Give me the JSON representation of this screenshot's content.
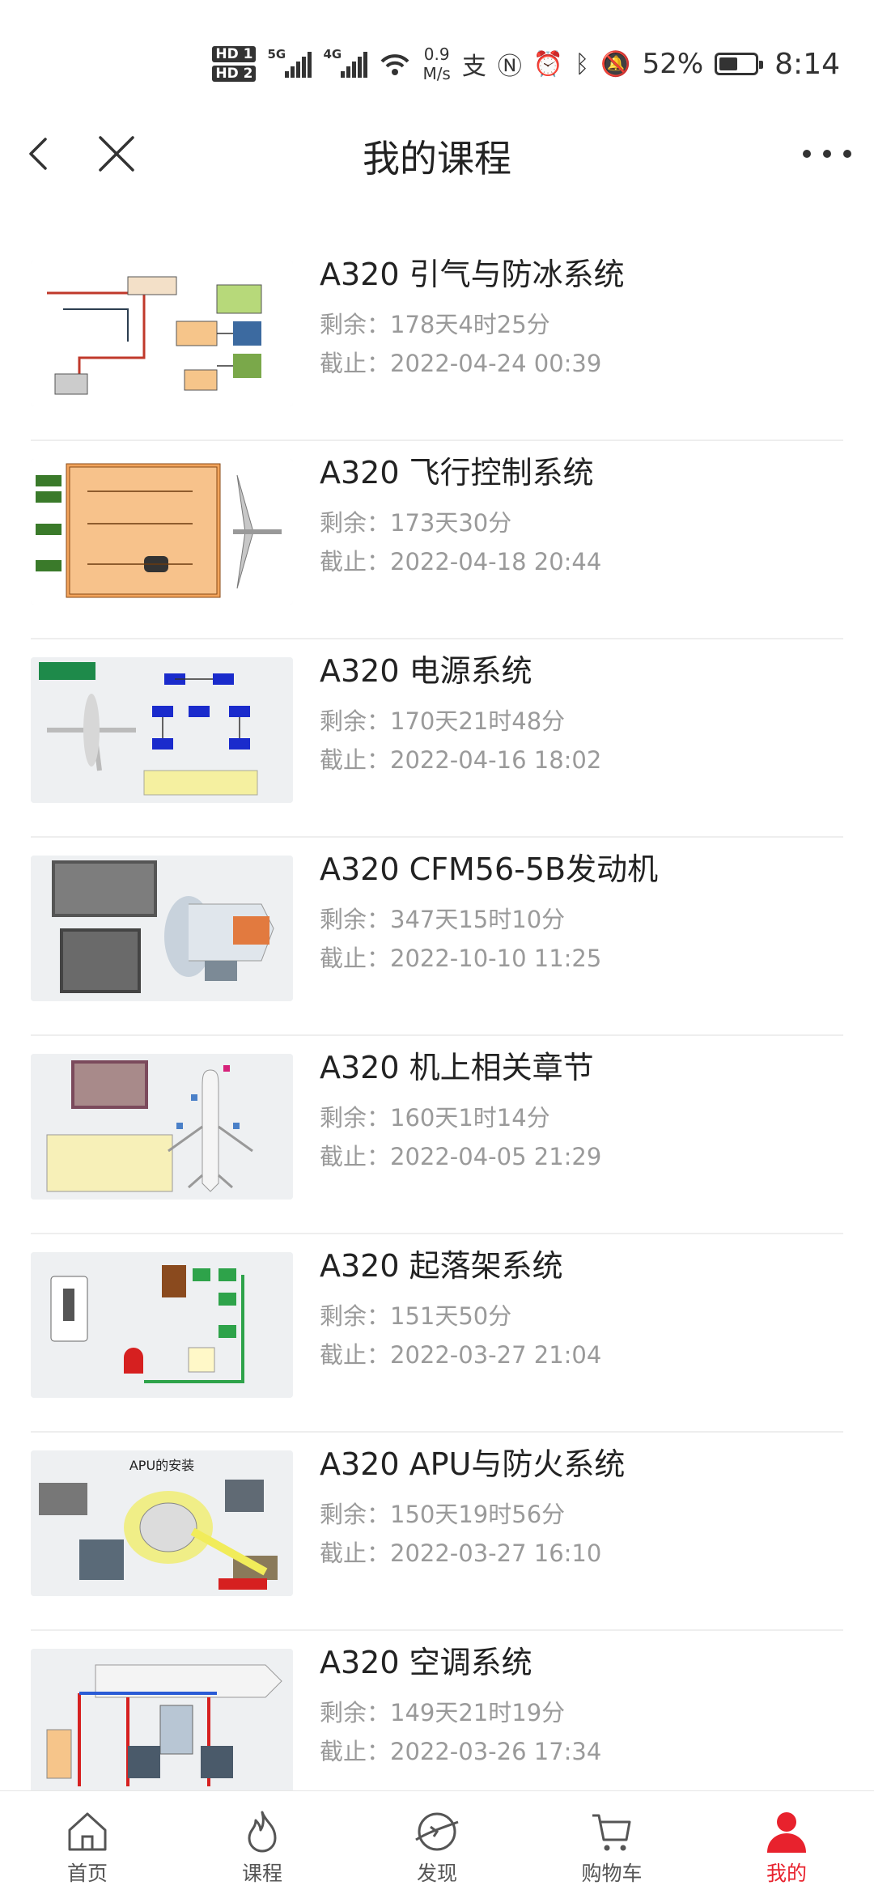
{
  "status_bar": {
    "hd1": "HD 1",
    "hd2": "HD 2",
    "sig1_label": "5G",
    "sig2_label": "4G",
    "speed_value": "0.9",
    "speed_unit": "M/s",
    "battery": "52%",
    "battery_level": 0.52,
    "time": "8:14"
  },
  "header": {
    "title": "我的课程"
  },
  "courses": [
    {
      "title": "A320 引气与防冰系统",
      "remain": "剩余：178天4时25分",
      "deadline": "截止：2022-04-24 00:39",
      "thumb_icon": "bleed-air-diagram-icon"
    },
    {
      "title": "A320 飞行控制系统",
      "remain": "剩余：173天30分",
      "deadline": "截止：2022-04-18 20:44",
      "thumb_icon": "flight-control-diagram-icon"
    },
    {
      "title": "A320 电源系统",
      "remain": "剩余：170天21时48分",
      "deadline": "截止：2022-04-16 18:02",
      "thumb_icon": "electrical-diagram-icon"
    },
    {
      "title": "A320 CFM56-5B发动机",
      "remain": "剩余：347天15时10分",
      "deadline": "截止：2022-10-10 11:25",
      "thumb_icon": "engine-diagram-icon"
    },
    {
      "title": "A320 机上相关章节",
      "remain": "剩余：160天1时14分",
      "deadline": "截止：2022-04-05 21:29",
      "thumb_icon": "aircraft-stations-diagram-icon"
    },
    {
      "title": "A320 起落架系统",
      "remain": "剩余：151天50分",
      "deadline": "截止：2022-03-27 21:04",
      "thumb_icon": "landing-gear-diagram-icon"
    },
    {
      "title": "A320 APU与防火系统",
      "remain": "剩余：150天19时56分",
      "deadline": "截止：2022-03-27 16:10",
      "thumb_icon": "apu-diagram-icon",
      "thumb_caption": "APU的安装"
    },
    {
      "title": "A320 空调系统",
      "remain": "剩余：149天21时19分",
      "deadline": "截止：2022-03-26 17:34",
      "thumb_icon": "air-conditioning-diagram-icon"
    }
  ],
  "bottom_nav": [
    {
      "label": "首页",
      "icon": "home-icon"
    },
    {
      "label": "课程",
      "icon": "flame-icon"
    },
    {
      "label": "发现",
      "icon": "discover-icon"
    },
    {
      "label": "购物车",
      "icon": "cart-icon"
    },
    {
      "label": "我的",
      "icon": "user-icon",
      "active": true
    }
  ],
  "colors": {
    "accent": "#e8222d",
    "text": "#222222",
    "subtext": "#9a9a9a",
    "divider": "#eeeeee"
  }
}
